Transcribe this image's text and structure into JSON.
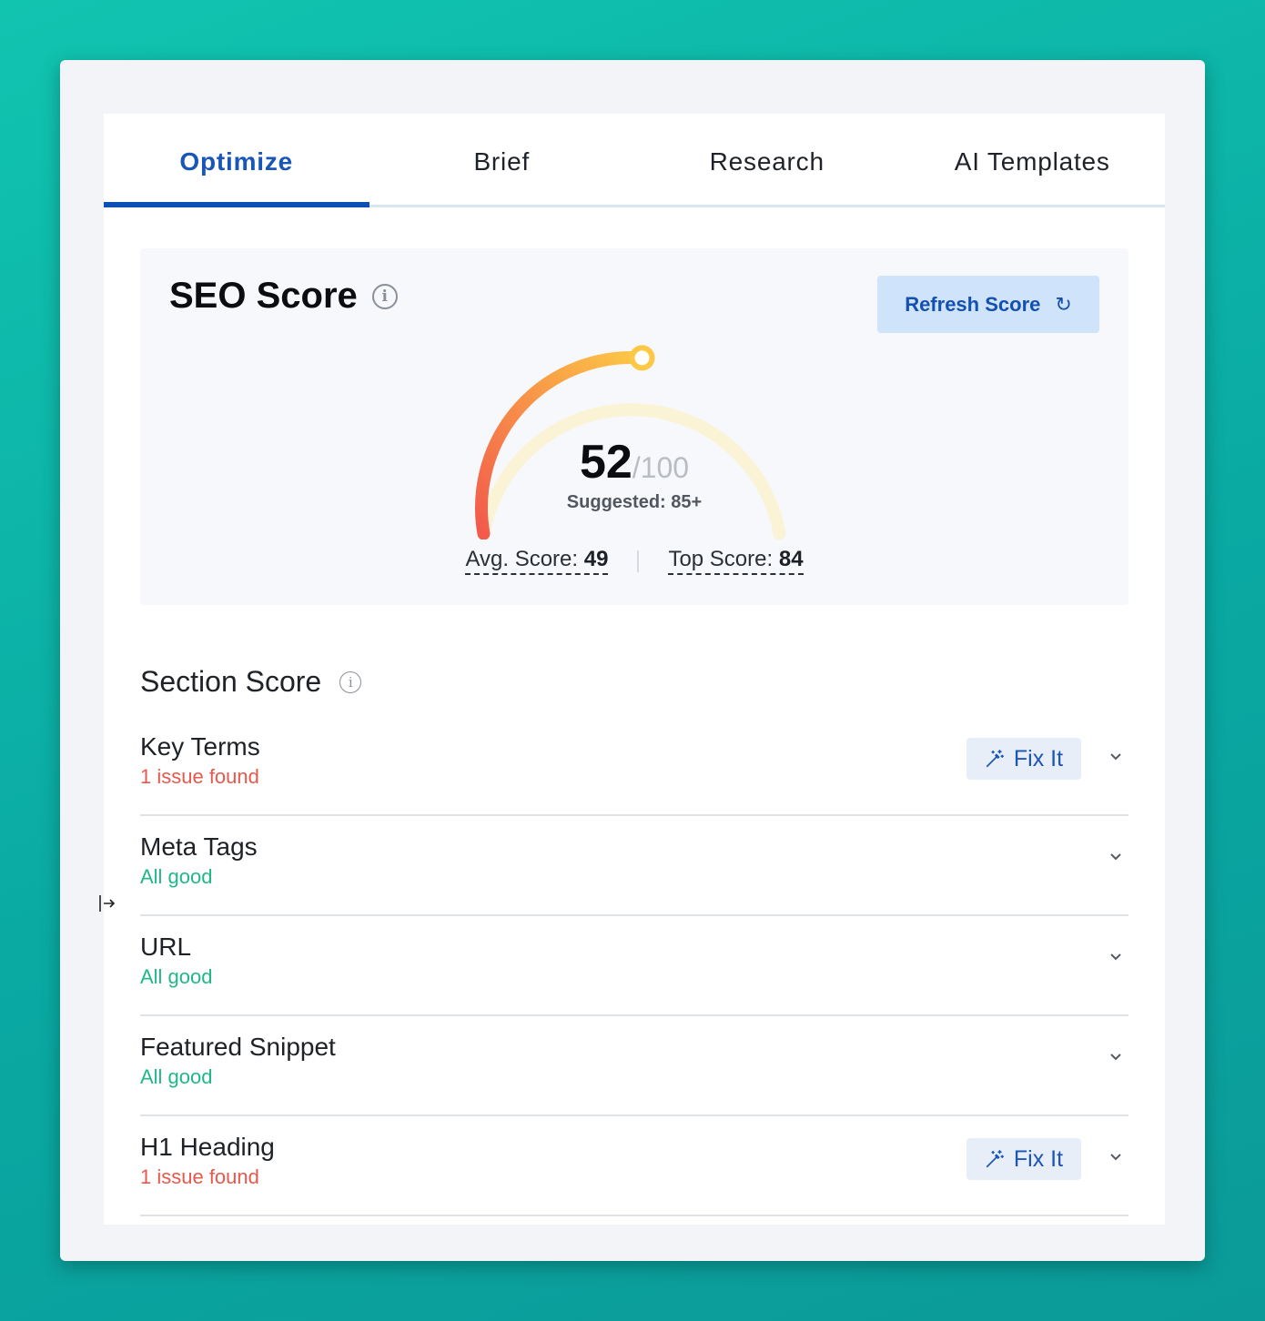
{
  "tabs": [
    {
      "label": "Optimize",
      "active": true
    },
    {
      "label": "Brief",
      "active": false
    },
    {
      "label": "Research",
      "active": false
    },
    {
      "label": "AI Templates",
      "active": false
    }
  ],
  "seo": {
    "title": "SEO Score",
    "info_icon": "info-icon",
    "refresh_label": "Refresh Score",
    "refresh_icon": "↻",
    "score": "52",
    "score_total": "/100",
    "score_value": 52,
    "score_max": 100,
    "suggested": "Suggested: 85+",
    "avg_label": "Avg. Score:",
    "avg_value": "49",
    "top_label": "Top Score:",
    "top_value": "84",
    "colors": {
      "gauge_start": "#f25a4c",
      "gauge_end": "#fcc845",
      "track": "#fbf3d6"
    }
  },
  "section": {
    "title": "Section Score",
    "rows": [
      {
        "name": "Key Terms",
        "status": "1 issue found",
        "state": "bad",
        "fix_label": "Fix It"
      },
      {
        "name": "Meta Tags",
        "status": "All good",
        "state": "good"
      },
      {
        "name": "URL",
        "status": "All good",
        "state": "good"
      },
      {
        "name": "Featured Snippet",
        "status": "All good",
        "state": "good"
      },
      {
        "name": "H1 Heading",
        "status": "1 issue found",
        "state": "bad",
        "fix_label": "Fix It"
      }
    ]
  }
}
